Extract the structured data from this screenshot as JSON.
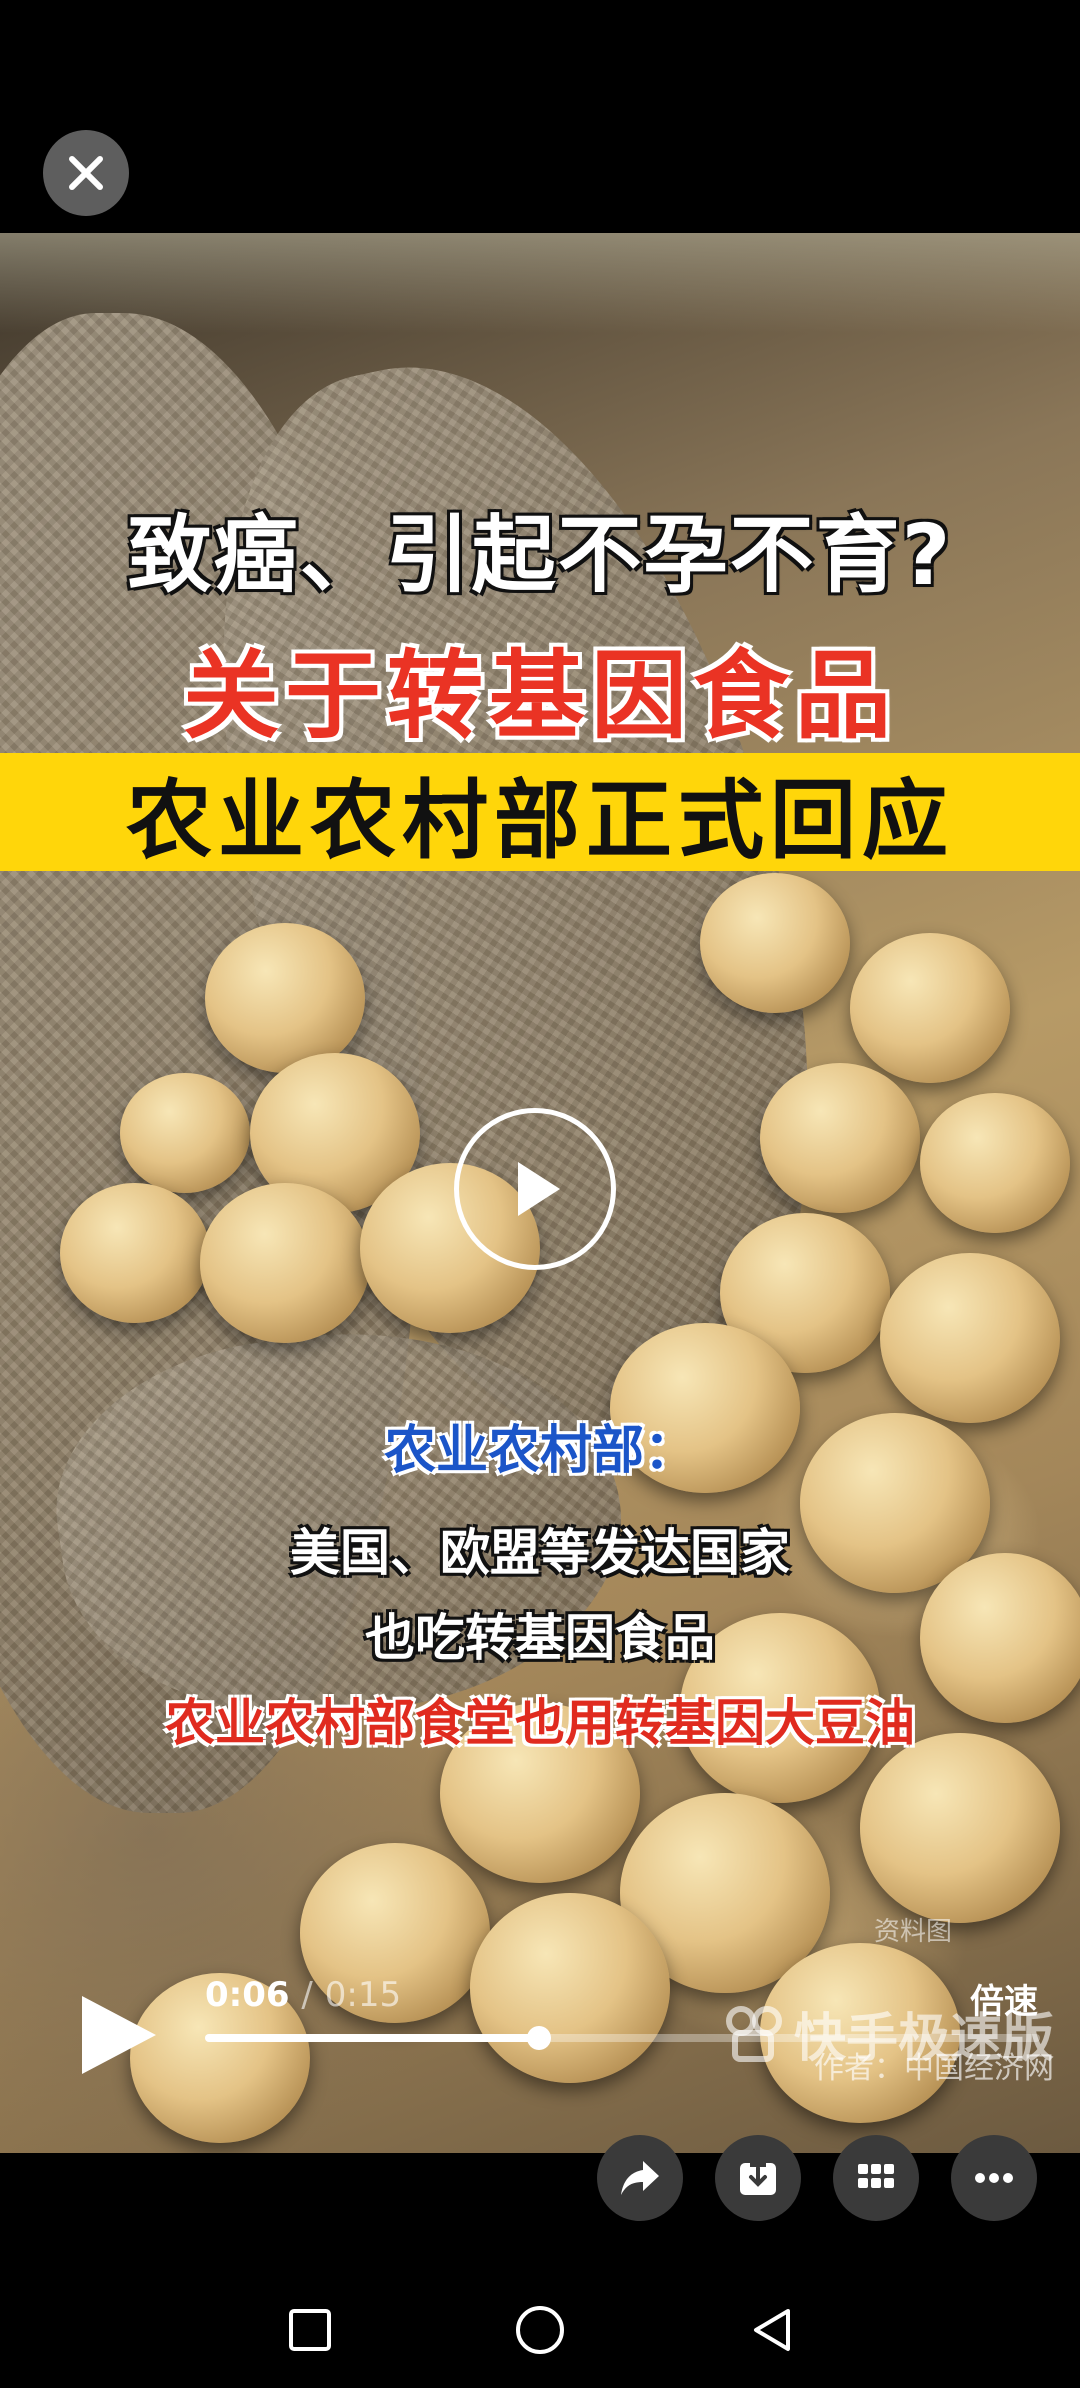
{
  "video": {
    "headline_line1": "致癌、引起不孕不育?",
    "headline_line2": "关于转基因食品",
    "headline_band": "农业农村部正式回应",
    "subtitle_speaker": "农业农村部：",
    "subtitle_line1": "美国、欧盟等发达国家",
    "subtitle_line2": "也吃转基因食品",
    "subtitle_line3": "农业农村部食堂也用转基因大豆油",
    "image_tag": "资料图",
    "watermark": "快手极速版",
    "author": "作者：中国经济网"
  },
  "player": {
    "current_time": "0:06",
    "separator": "/",
    "duration": "0:15",
    "speed_label": "倍速",
    "progress": 0.4
  },
  "actions": {
    "share_icon": "share-arrow-icon",
    "download_icon": "download-icon",
    "apps_icon": "grid-apps-icon",
    "more_icon": "more-dots-icon"
  },
  "colors": {
    "band_yellow": "#ffd60a",
    "headline_red": "#ea3324",
    "speaker_blue": "#1b55c8"
  }
}
